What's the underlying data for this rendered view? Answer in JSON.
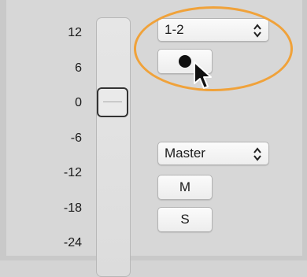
{
  "scale": {
    "ticks": [
      "12",
      "6",
      "0",
      "-6",
      "-12",
      "-18",
      "-24"
    ]
  },
  "input_select": {
    "value": "1-2"
  },
  "output_select": {
    "value": "Master"
  },
  "buttons": {
    "mute_label": "M",
    "solo_label": "S"
  },
  "icons": {
    "record": "record-dot-icon",
    "cursor": "mouse-pointer-icon",
    "popup_arrows": "up-down-chevron-icon"
  },
  "colors": {
    "highlight": "#f0a23a",
    "background": "#d7d7d7"
  }
}
